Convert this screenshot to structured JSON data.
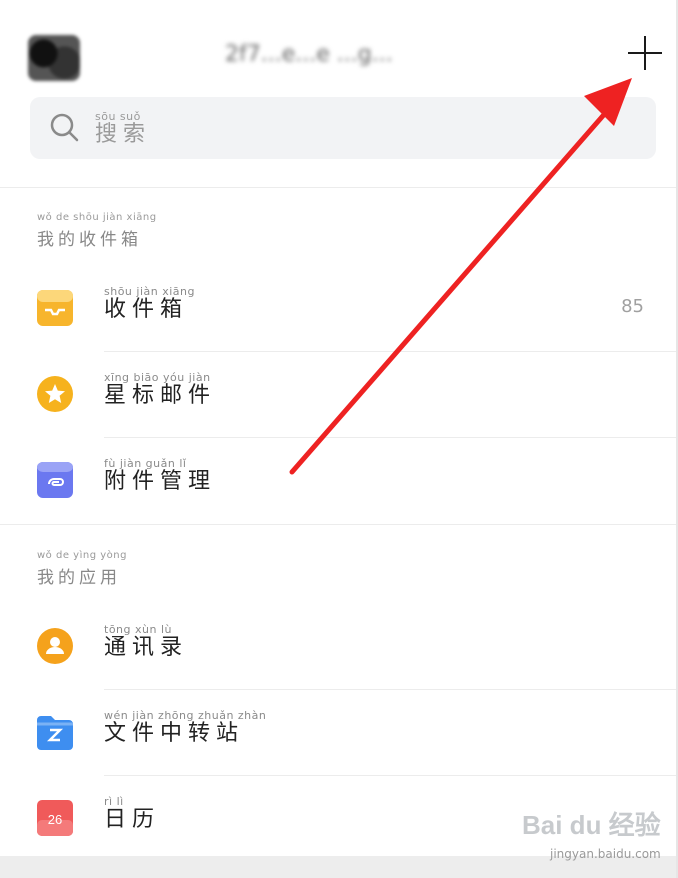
{
  "header": {
    "account_name": "2f7...e...e ...g...",
    "compose_icon": "plus-icon"
  },
  "search": {
    "pinyin": "sōu suǒ",
    "label": "搜索",
    "icon": "search-icon"
  },
  "sections": [
    {
      "pinyin": "wǒ de shōu jiàn xiāng",
      "title": "我的收件箱",
      "items": [
        {
          "pinyin": "shōu jiàn xiāng",
          "label": "收件箱",
          "count": "85",
          "icon": "inbox-icon",
          "color": "#f7b52c"
        },
        {
          "pinyin": "xīng biāo yóu jiàn",
          "label": "星标邮件",
          "count": "",
          "icon": "star-icon",
          "color": "#f6b21d"
        },
        {
          "pinyin": "fù jiàn guǎn lǐ",
          "label": "附件管理",
          "count": "",
          "icon": "attachment-icon",
          "color": "#6b78f0"
        }
      ]
    },
    {
      "pinyin": "wǒ de yìng yòng",
      "title": "我的应用",
      "items": [
        {
          "pinyin": "tōng xùn lù",
          "label": "通讯录",
          "count": "",
          "icon": "contacts-icon",
          "color": "#f5a21c"
        },
        {
          "pinyin": "wén jiàn zhōng zhuǎn zhàn",
          "label": "文件中转站",
          "count": "",
          "icon": "folder-icon",
          "color": "#3e8ef0"
        },
        {
          "pinyin": "rì lì",
          "label": "日历",
          "count": "",
          "icon": "calendar-icon",
          "color": "#f05a5a",
          "badge": "26"
        }
      ]
    }
  ],
  "watermark": {
    "text": "Bai du 经验",
    "url": "jingyan.baidu.com"
  }
}
